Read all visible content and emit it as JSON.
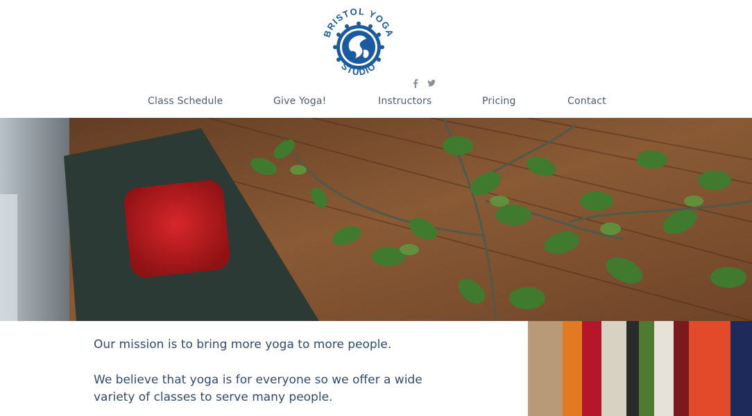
{
  "brand": {
    "logo_top": "BRISTOL YOGA",
    "logo_bottom": "STUDIO",
    "color": "#1a5aa0"
  },
  "social": {
    "icons": [
      "facebook-icon",
      "twitter-icon"
    ]
  },
  "nav": {
    "items": [
      {
        "label": "Class Schedule"
      },
      {
        "label": "Give Yoga!"
      },
      {
        "label": "Instructors"
      },
      {
        "label": "Pricing"
      },
      {
        "label": "Contact"
      }
    ]
  },
  "mission": {
    "line1": "Our mission is to bring more yoga to more people.",
    "line2": "We believe that yoga is for everyone so we offer a wide variety of classes to serve many people."
  },
  "colors": {
    "nav_text": "#4a5a72",
    "mission_text": "#2f4a72",
    "floor": "#7a4a2a",
    "mat": "#2c3a35",
    "block": "#c41b1d"
  }
}
